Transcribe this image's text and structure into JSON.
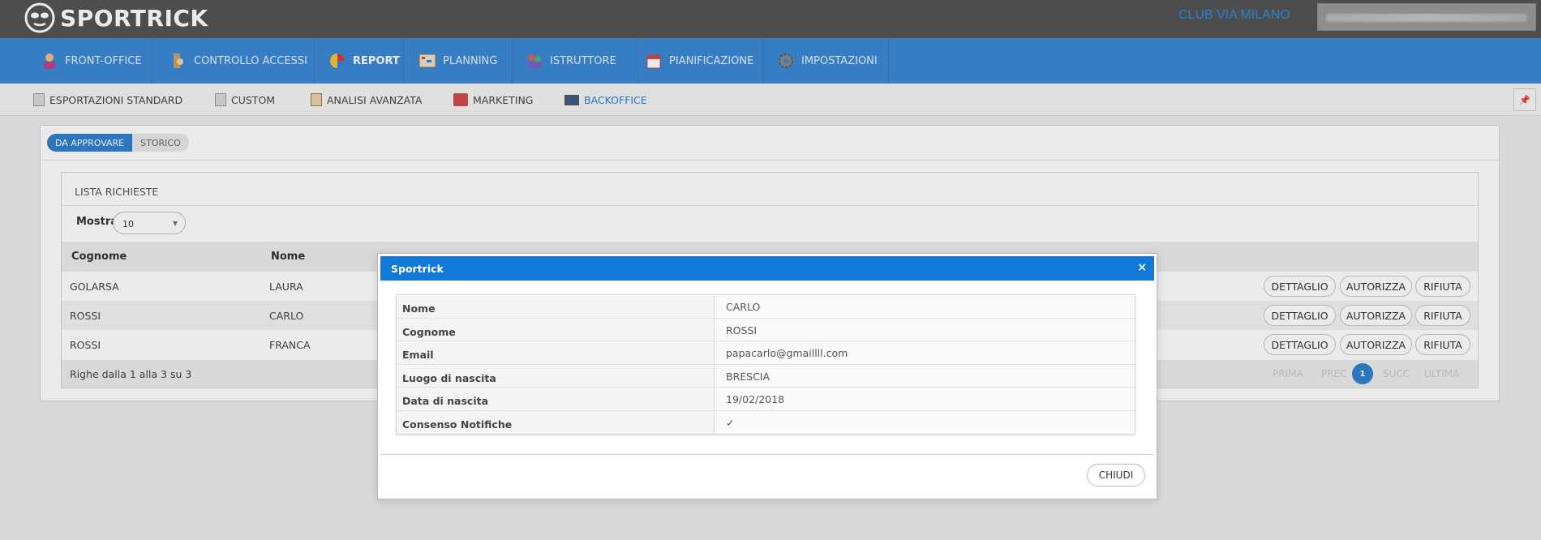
{
  "header": {
    "brand": "SPORTRICK",
    "club": "CLUB VIA MILANO"
  },
  "mainnav": {
    "items": [
      {
        "label": "FRONT-OFFICE",
        "icon": "person-icon"
      },
      {
        "label": "CONTROLLO ACCESSI",
        "icon": "access-control-icon"
      },
      {
        "label": "REPORT",
        "icon": "pie-chart-icon",
        "active": true
      },
      {
        "label": "PLANNING",
        "icon": "planning-board-icon"
      },
      {
        "label": "ISTRUTTORE",
        "icon": "instructors-icon"
      },
      {
        "label": "PIANIFICAZIONE",
        "icon": "calendar-icon"
      },
      {
        "label": "IMPOSTAZIONI",
        "icon": "gear-icon"
      }
    ]
  },
  "subnav": {
    "items": [
      {
        "label": "ESPORTAZIONI STANDARD",
        "icon": "document-icon"
      },
      {
        "label": "CUSTOM",
        "icon": "document-icon"
      },
      {
        "label": "ANALISI AVANZATA",
        "icon": "clipboard-icon"
      },
      {
        "label": "MARKETING",
        "icon": "megaphone-icon"
      },
      {
        "label": "BACKOFFICE",
        "icon": "monitor-icon",
        "active": true
      }
    ],
    "pin_icon": "pin-icon"
  },
  "panel": {
    "tabs": [
      "DA APPROVARE",
      "STORICO"
    ],
    "list_title": "LISTA RICHIESTE",
    "show_label": "Mostra",
    "show_value": "10",
    "columns": [
      "Cognome",
      "Nome"
    ],
    "rows": [
      {
        "cognome": "GOLARSA",
        "nome": "LAURA"
      },
      {
        "cognome": "ROSSI",
        "nome": "CARLO"
      },
      {
        "cognome": "ROSSI",
        "nome": "FRANCA"
      }
    ],
    "actions": {
      "detail": "DETTAGLIO",
      "approve": "AUTORIZZA",
      "reject": "RIFIUTA"
    },
    "footer_text": "Righe dalla 1 alla 3 su 3",
    "pagination": {
      "first": "PRIMA",
      "prev": "PREC",
      "current": "1",
      "next": "SUCC",
      "last": "ULTIMA"
    }
  },
  "modal": {
    "title": "Sportrick",
    "close_symbol": "×",
    "fields": [
      {
        "label": "Nome",
        "value": "CARLO"
      },
      {
        "label": "Cognome",
        "value": "ROSSI"
      },
      {
        "label": "Email",
        "value": "papacarlo@gmaillll.com"
      },
      {
        "label": "Luogo di nascita",
        "value": "BRESCIA"
      },
      {
        "label": "Data di nascita",
        "value": "19/02/2018"
      },
      {
        "label": "Consenso Notifiche",
        "value": "✓"
      }
    ],
    "close_button": "CHIUDI"
  },
  "colors": {
    "topbar": "#545454",
    "nav": "#3b88d4",
    "accent": "#1279d8",
    "club": "#2b8be2"
  }
}
